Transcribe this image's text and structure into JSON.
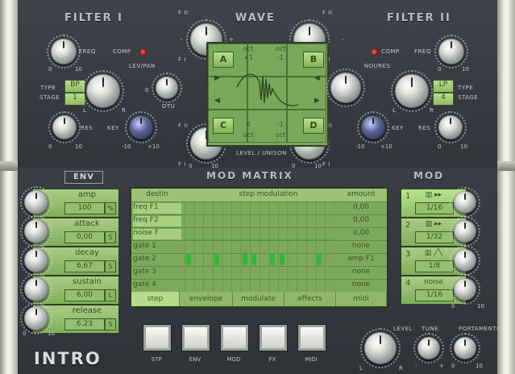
{
  "filter1": {
    "title": "FILTER I",
    "freq": "FREQ",
    "comp": "COMP",
    "lev_pan": "LEV/PAN",
    "type": "TYPE",
    "stage": "STAGE",
    "type_value": "BP",
    "stage_value": "1",
    "res": "RES",
    "key": "KEY",
    "dtu": "DTU",
    "freq_min": "0",
    "freq_max": "10",
    "res_min": "0",
    "res_max": "10",
    "key_min": "-10",
    "key_max": "+10",
    "pan_l": "L",
    "pan_r": "R",
    "dtu_zero": "0"
  },
  "filter2": {
    "title": "FILTER II",
    "comp": "COMP",
    "freq": "FREQ",
    "noi_res": "NOI/RES",
    "type": "TYPE",
    "stage": "STAGE",
    "type_value": "LP",
    "stage_value": "4",
    "res": "RES",
    "key": "KEY",
    "freq_min": "0",
    "freq_max": "10",
    "res_min": "0",
    "res_max": "10",
    "key_min": "-10",
    "key_max": "+10",
    "pan_l": "L",
    "pan_r": "R"
  },
  "wave": {
    "title": "WAVE",
    "f1": "F I",
    "f2": "F II",
    "plus": "+",
    "minus": "-",
    "level_unison": "LEVEL / UNISON",
    "zero": "0",
    "ten": "10",
    "osc": [
      {
        "name": "A",
        "oct_label": "oct",
        "oct_value": "+1"
      },
      {
        "name": "B",
        "oct_label": "oct",
        "oct_value": "-1"
      },
      {
        "name": "C",
        "oct_label": "oct",
        "oct_value": "0"
      },
      {
        "name": "D",
        "oct_label": "oct",
        "oct_value": "-1"
      }
    ]
  },
  "env": {
    "title": "ENV",
    "params": [
      {
        "name": "amp",
        "value": "100",
        "unit": "%"
      },
      {
        "name": "attack",
        "value": "0,00",
        "unit": "S"
      },
      {
        "name": "decay",
        "value": "6,67",
        "unit": "S"
      },
      {
        "name": "sustain",
        "value": "6,00",
        "unit": "L"
      },
      {
        "name": "release",
        "value": "6,23",
        "unit": "S"
      }
    ],
    "zero": "0",
    "ten": "10"
  },
  "matrix": {
    "title": "MOD MATRIX",
    "header": {
      "destin": "destin",
      "step": "step modulation",
      "amount": "amount"
    },
    "rows": [
      {
        "dest": "freq F1",
        "amount": "0,00"
      },
      {
        "dest": "freq F2",
        "amount": "0,00"
      },
      {
        "dest": "noise F",
        "amount": "0,00"
      },
      {
        "dest": "gate 1",
        "amount": "none"
      },
      {
        "dest": "gate 2",
        "amount": "amp F1"
      },
      {
        "dest": "gate 3",
        "amount": "none"
      },
      {
        "dest": "gate 4",
        "amount": "none"
      }
    ],
    "tabs": [
      "step",
      "envelope",
      "modulate",
      "effects",
      "midi"
    ],
    "gate2_steps": [
      1,
      0,
      0,
      1,
      0,
      0,
      1,
      1,
      0,
      1,
      1,
      0,
      0,
      0,
      1,
      0
    ]
  },
  "mod": {
    "title": "MOD",
    "slots": [
      {
        "num": "1",
        "sub": "▥ ▸▸",
        "rate": "1/16"
      },
      {
        "num": "2",
        "sub": "▥ ▸▸",
        "rate": "1/32"
      },
      {
        "num": "3",
        "sub": "▥ ╱╲",
        "rate": "1/8"
      },
      {
        "num": "4",
        "sub": "noise",
        "rate": "1/16"
      }
    ],
    "zero": "0",
    "ten": "10"
  },
  "bottom": {
    "logo": "INTRO",
    "pads": [
      "STP",
      "ENV",
      "MOD",
      "FX",
      "MIDI"
    ],
    "level": "LEVEL",
    "tune": "TUNE",
    "portamento": "PORTAMENTO",
    "l": "L",
    "r": "R",
    "minus": "-",
    "plus": "+",
    "zero": "0",
    "ten": "10"
  },
  "colors": {
    "lcd_green": "#7ea95c",
    "step_green": "#2fb83b",
    "led_red": "#d21a10",
    "panel": "#3b3f45"
  }
}
